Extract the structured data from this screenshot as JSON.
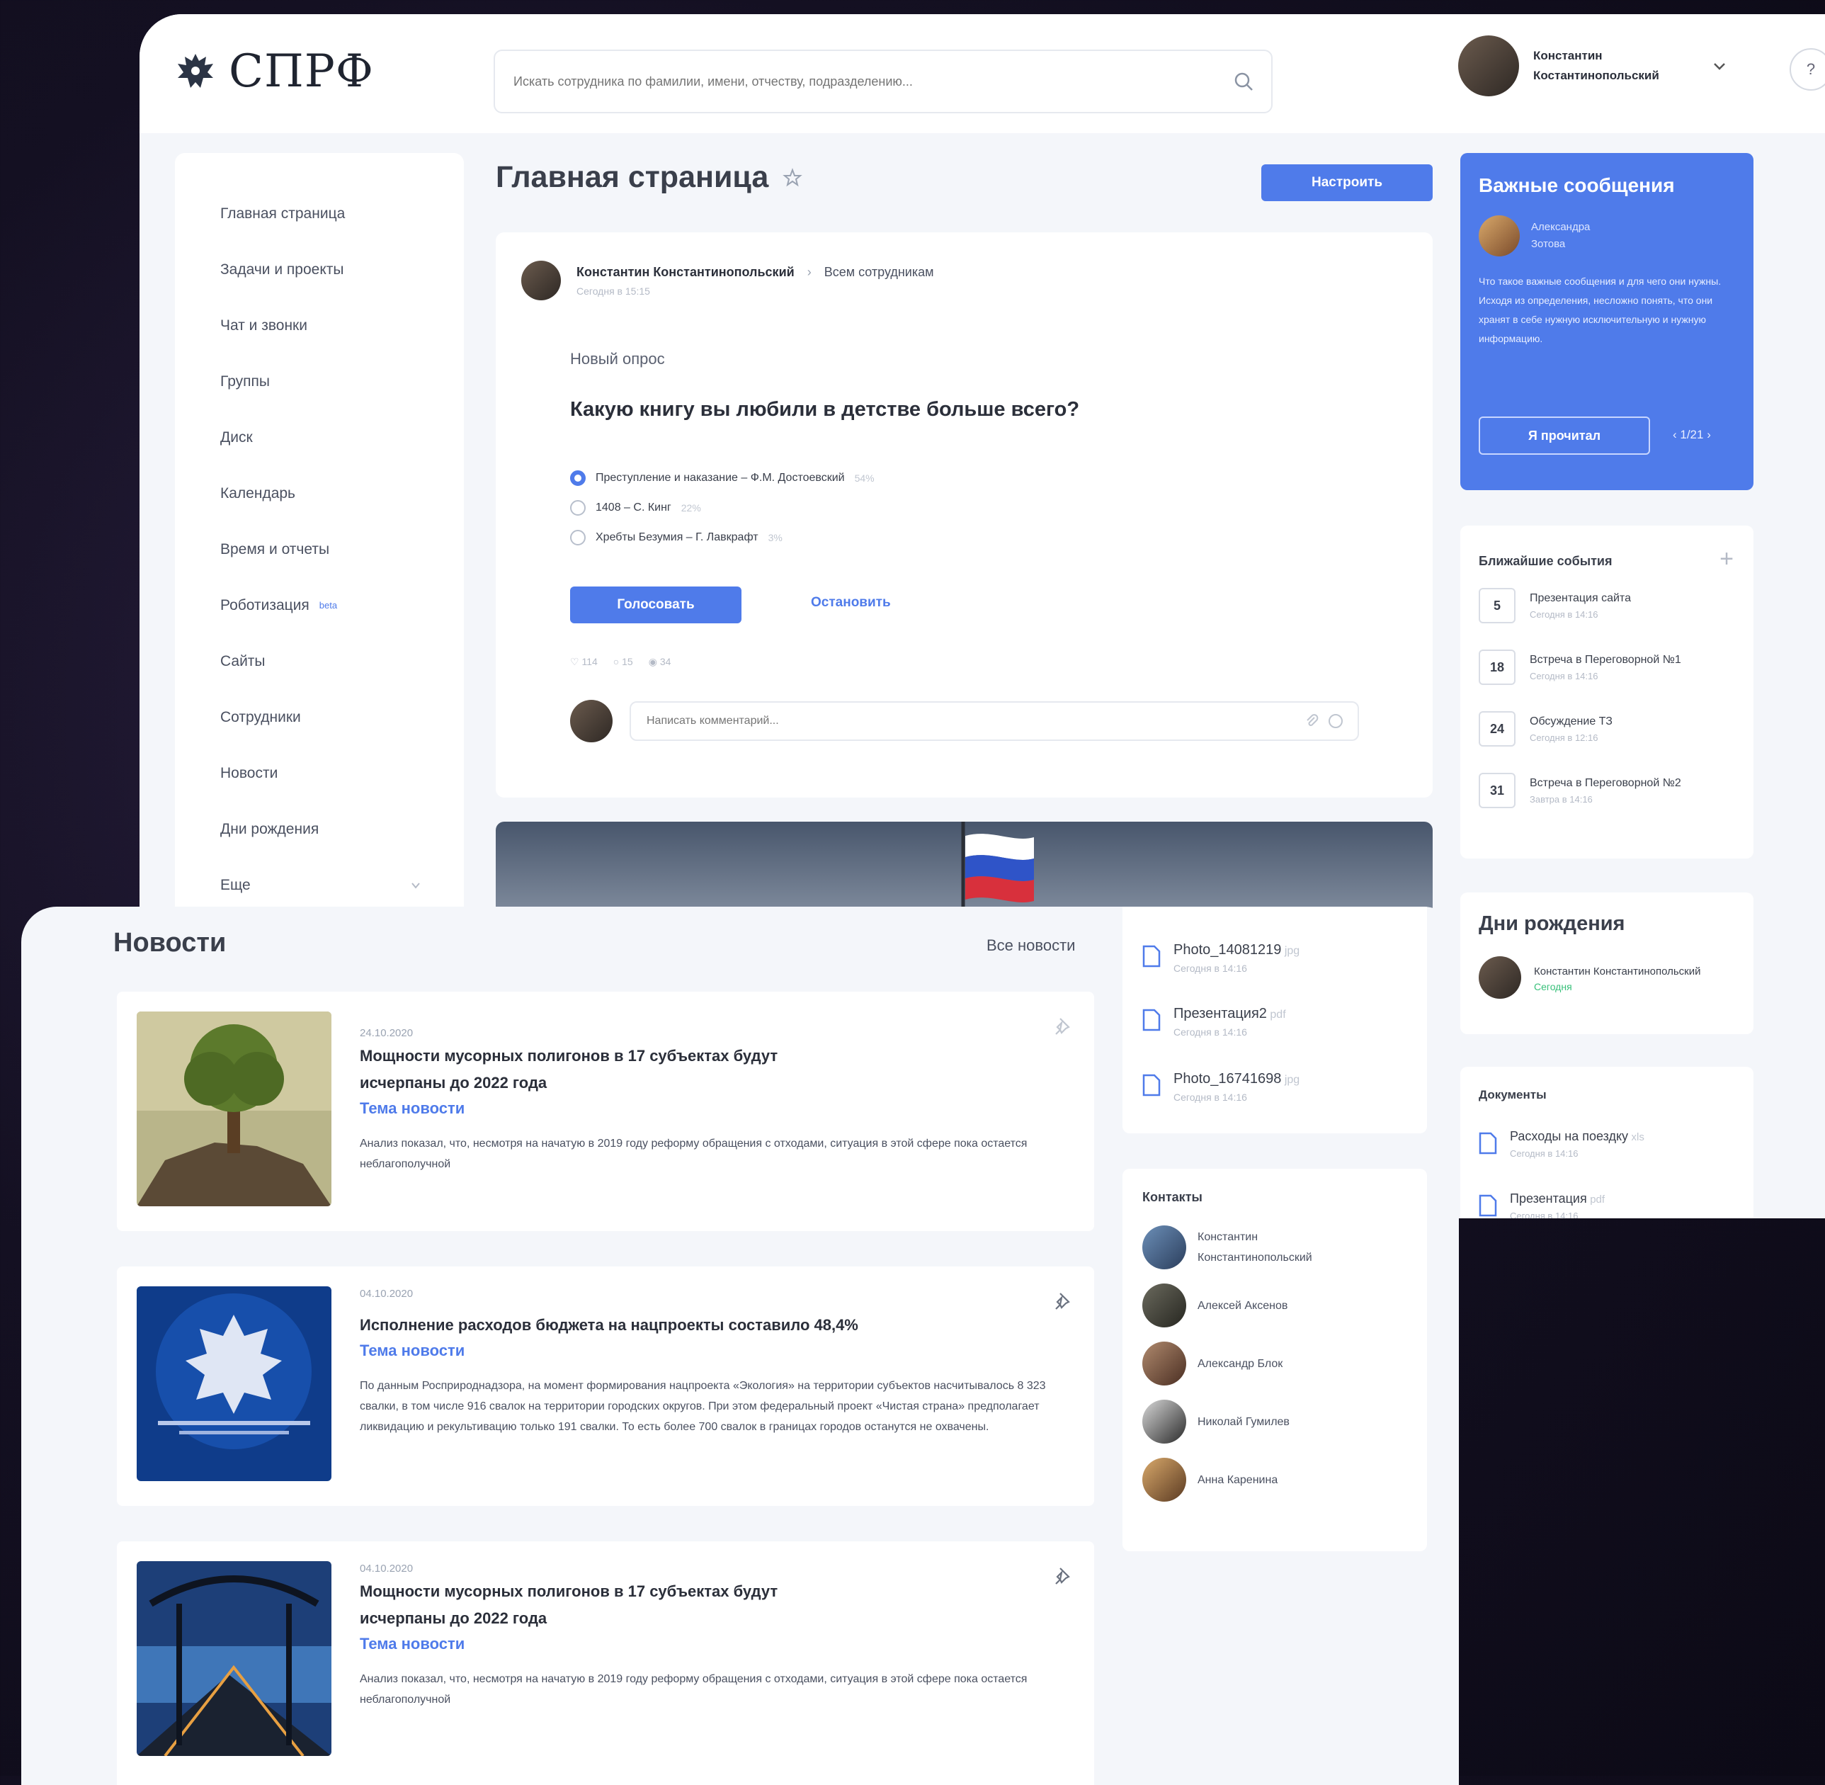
{
  "header": {
    "logo_text": "СПРФ",
    "search_placeholder": "Искать сотрудника по фамилии, имени, отчеству, подразделению...",
    "user_name": "Константин Костантинопольский"
  },
  "sidebar": {
    "items": [
      {
        "label": "Главная страница"
      },
      {
        "label": "Задачи и проекты"
      },
      {
        "label": "Чат и звонки"
      },
      {
        "label": "Группы"
      },
      {
        "label": "Диск"
      },
      {
        "label": "Календарь"
      },
      {
        "label": "Время и отчеты"
      },
      {
        "label": "Роботизация",
        "badge": "beta"
      },
      {
        "label": "Сайты"
      },
      {
        "label": "Сотрудники"
      },
      {
        "label": "Новости"
      },
      {
        "label": "Дни рождения"
      },
      {
        "label": "Еще"
      }
    ]
  },
  "main": {
    "page_title": "Главная страница",
    "configure_label": "Настроить",
    "post": {
      "author": "Константин Константинопольский",
      "audience": "Всем сотрудникам",
      "time": "Сегодня в 15:15",
      "poll_kind": "Новый опрос",
      "question": "Какую книгу вы любили в детстве больше всего?",
      "options": [
        {
          "text": "Преступление и наказание – Ф.М. Достоевский",
          "pct": "54%",
          "selected": true
        },
        {
          "text": "1408 – С. Кинг",
          "pct": "22%",
          "selected": false
        },
        {
          "text": "Хребты Безумия – Г. Лавкрафт",
          "pct": "3%",
          "selected": false
        }
      ],
      "vote_label": "Голосовать",
      "stop_label": "Остановить",
      "stats": {
        "likes": "114",
        "comments": "15",
        "views": "34"
      },
      "comment_placeholder": "Написать комментарий..."
    }
  },
  "important": {
    "title": "Важные сообщения",
    "sender": "Александра Зотова",
    "body": "Что такое важные сообщения и для чего они нужны. Исходя из определения, несложно понять, что они хранят в себе нужную исключительную и нужную информацию.",
    "read_label": "Я прочитал",
    "pager": "‹ 1/21 ›"
  },
  "events": {
    "title": "Ближайшие события",
    "items": [
      {
        "day": "5",
        "name": "Презентация сайта",
        "time": "Сегодня в 14:16"
      },
      {
        "day": "18",
        "name": "Встреча в Переговорной №1",
        "time": "Сегодня в 14:16"
      },
      {
        "day": "24",
        "name": "Обсуждение ТЗ",
        "time": "Сегодня в 12:16"
      },
      {
        "day": "31",
        "name": "Встреча в Переговорной №2",
        "time": "Завтра в 14:16"
      }
    ]
  },
  "birthdays": {
    "title": "Дни рождения",
    "name": "Константин Константинопольский",
    "when": "Сегодня"
  },
  "documents": {
    "title": "Документы",
    "items": [
      {
        "name": "Расходы на поездку",
        "ext": "xls",
        "time": "Сегодня в 14:16"
      },
      {
        "name": "Презентация",
        "ext": "pdf",
        "time": "Сегодня в 14:16"
      }
    ]
  },
  "news": {
    "title": "Новости",
    "all_label": "Все новости",
    "items": [
      {
        "date": "24.10.2020",
        "headline": "Мощности мусорных полигонов в 17 субъектах будут исчерпаны до 2022 года",
        "topic": "Тема новости",
        "text": "Анализ показал, что, несмотря на начатую в 2019 году реформу обращения с отходами, ситуация в этой сфере пока остается неблагополучной"
      },
      {
        "date": "04.10.2020",
        "headline": "Исполнение расходов бюджета на нацпроекты составило 48,4%",
        "topic": "Тема новости",
        "text": "По данным Росприроднадзора, на момент формирования нацпроекта «Экология» на территории субъектов насчитывалось 8 323 свалки, в том числе 916 свалок на территории городских округов. При этом федеральный проект «Чистая страна» предполагает ликвидацию и рекультивацию только 191 свалки. То есть более 700 свалок в границах городов останутся не охвачены."
      },
      {
        "date": "04.10.2020",
        "headline": "Мощности мусорных полигонов в 17 субъектах будут исчерпаны до 2022 года",
        "topic": "Тема новости",
        "text": "Анализ показал, что, несмотря на начатую в 2019 году реформу обращения с отходами, ситуация в этой сфере пока остается неблагополучной"
      }
    ]
  },
  "files": {
    "items": [
      {
        "name": "Photo_14081219",
        "ext": "jpg",
        "time": "Сегодня в 14:16"
      },
      {
        "name": "Презентация2",
        "ext": "pdf",
        "time": "Сегодня в 14:16"
      },
      {
        "name": "Photo_16741698",
        "ext": "jpg",
        "time": "Сегодня в 14:16"
      }
    ]
  },
  "contacts": {
    "title": "Контакты",
    "items": [
      {
        "name": "Константин Константинопольский"
      },
      {
        "name": "Алексей Аксенов"
      },
      {
        "name": "Александр Блок"
      },
      {
        "name": "Николай Гумилев"
      },
      {
        "name": "Анна Каренина"
      }
    ]
  },
  "colors": {
    "accent": "#4f7bea",
    "success": "#38c07a",
    "background": "#f4f6fa"
  }
}
